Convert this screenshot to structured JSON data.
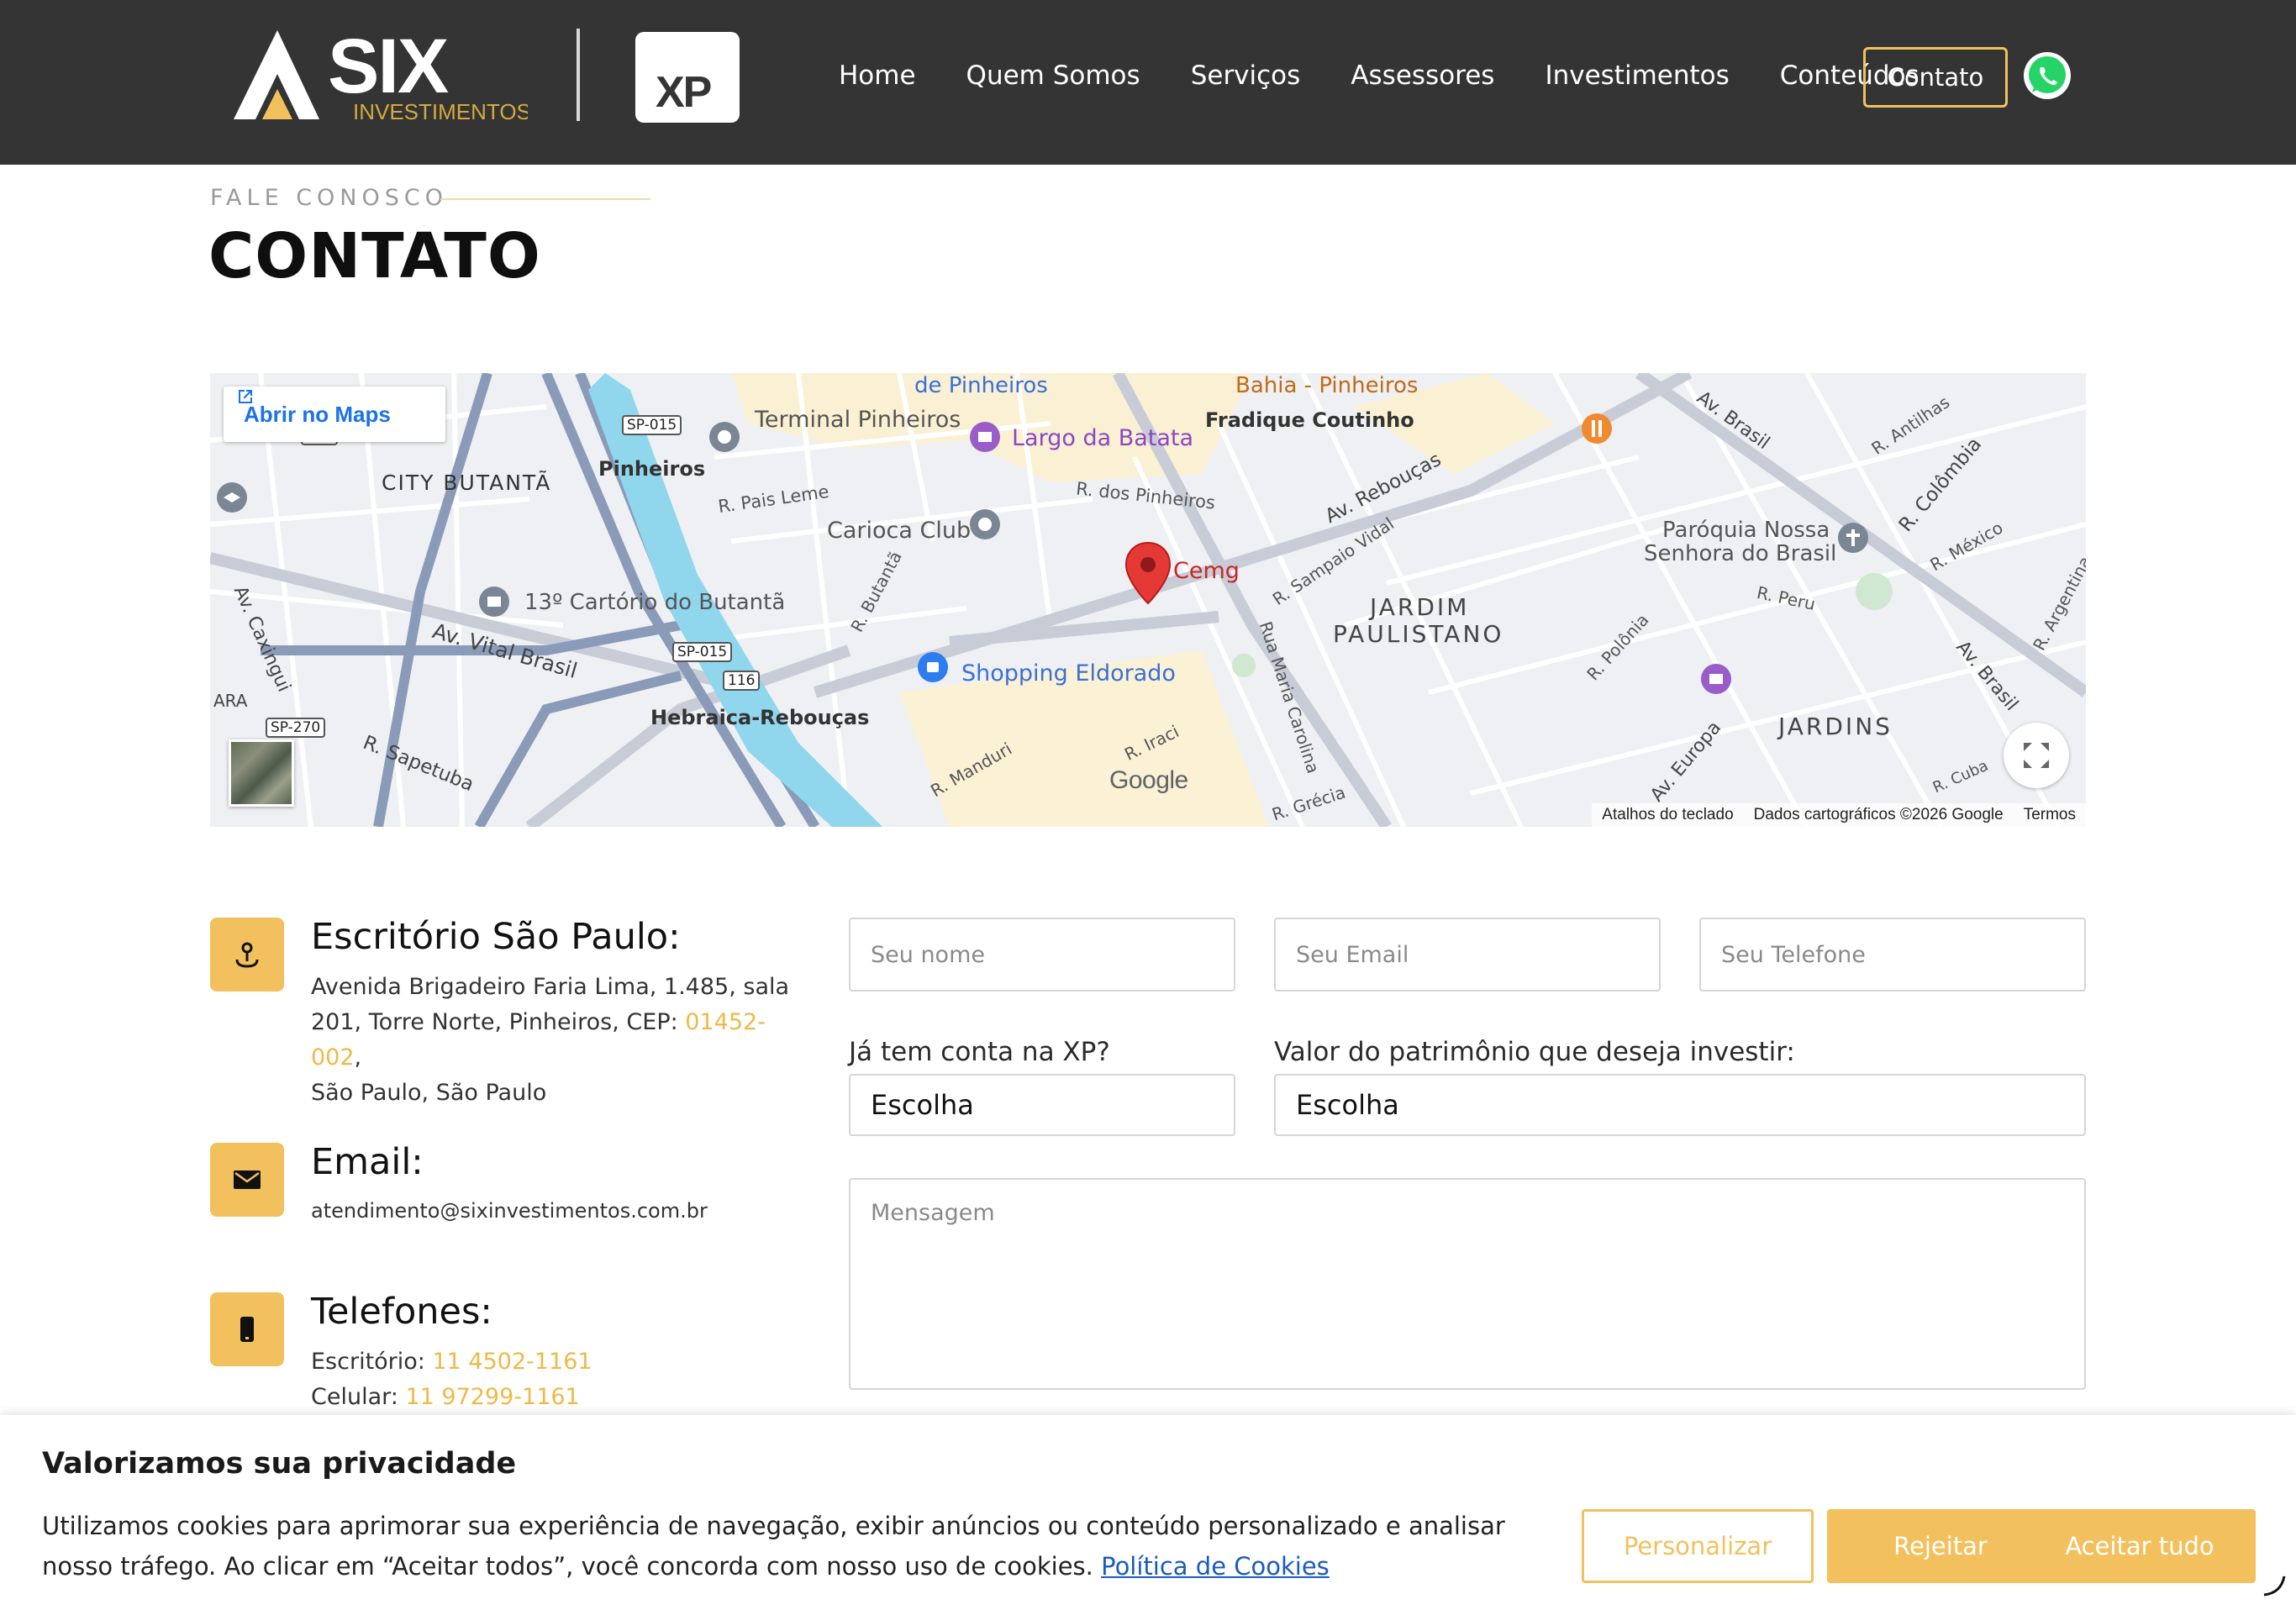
{
  "header": {
    "logo_brand": "SIX",
    "logo_sub": "INVESTIMENTOS",
    "partner_logo": "XP",
    "nav": [
      "Home",
      "Quem Somos",
      "Serviços",
      "Assessores",
      "Investimentos",
      "Conteúdos"
    ],
    "contact_button": "Contato",
    "whatsapp_icon": "whatsapp-icon"
  },
  "title": {
    "eyebrow": "FALE CONOSCO",
    "heading": "CONTATO"
  },
  "map": {
    "open_in_maps": "Abrir no Maps",
    "marker_label": "Cemg",
    "places": {
      "terminal": "Terminal Pinheiros",
      "largo": "Largo da Batata",
      "fradique": "Fradique Coutinho",
      "bahia": "Bahia - Pinheiros",
      "mercado": "de Pinheiros",
      "city": "CITY BUTANTÃ",
      "pinheiros": "Pinheiros",
      "pais_leme": "R. Pais Leme",
      "dos_pinheiros": "R. dos Pinheiros",
      "carioca": "Carioca Club",
      "reboucas": "Av. Rebouças",
      "cartorio": "13º Cartório do Butantã",
      "butanta": "R. Butantã",
      "sampaio": "R. Sampaio Vidal",
      "jardim1": "JARDIM",
      "jardim2": "PAULISTANO",
      "vital": "Av. Vital Brasil",
      "shopping": "Shopping Eldorado",
      "hebraica": "Hebraica-Rebouças",
      "caxingui": "Av. Caxingui",
      "sapetuba": "R. Sapetuba",
      "manduri": "R. Manduri",
      "iraci": "R. Iraci",
      "maria": "Rua Maria Carolina",
      "grecia": "R. Grécia",
      "polonia": "R. Polônia",
      "europa": "Av. Europa",
      "jardins": "JARDINS",
      "paroquia1": "Paróquia Nossa",
      "paroquia2": "Senhora do Brasil",
      "peru": "R. Peru",
      "colombia": "R. Colômbia",
      "mexico": "R. México",
      "antilhas": "R. Antilhas",
      "av_brasil": "Av. Brasil",
      "argentina": "R. Argentina",
      "cuba": "R. Cuba",
      "ara": "ARA",
      "sp015a": "SP-015",
      "sp015b": "SP-015",
      "r116a": "116",
      "r116b": "116",
      "sp270": "SP-270"
    },
    "footer": {
      "shortcuts": "Atalhos do teclado",
      "data": "Dados cartográficos ©2026 Google",
      "terms": "Termos"
    },
    "google": "Google"
  },
  "office": {
    "title": "Escritório São Paulo:",
    "line1": "Avenida Brigadeiro Faria Lima, 1.485, sala",
    "line2a": "201, Torre Norte, Pinheiros, CEP: ",
    "cep": "01452-002",
    "line2b": ",",
    "line3": "São Paulo, São Paulo"
  },
  "email": {
    "title": "Email:",
    "address": "atendimento@sixinvestimentos.com.br"
  },
  "phones": {
    "title": "Telefones:",
    "office_label": "Escritório: ",
    "office_number": "11 4502-1161",
    "cell_label": "Celular: ",
    "cell_number": "11 97299-1161"
  },
  "form": {
    "name_placeholder": "Seu nome",
    "email_placeholder": "Seu Email",
    "phone_placeholder": "Seu Telefone",
    "xp_account_label": "Já tem conta na XP?",
    "xp_account_value": "Escolha",
    "patrimony_label": "Valor do patrimônio que deseja investir:",
    "patrimony_value": "Escolha",
    "message_placeholder": "Mensagem"
  },
  "cookie": {
    "title": "Valorizamos sua privacidade",
    "text": "Utilizamos cookies para aprimorar sua experiência de navegação, exibir anúncios ou conteúdo personalizado e analisar nosso tráfego. Ao clicar em “Aceitar todos”, você concorda com nosso uso de cookies. ",
    "link": "Política de Cookies",
    "customize": "Personalizar",
    "reject": "Rejeitar",
    "accept": "Aceitar tudo"
  },
  "colors": {
    "accent": "#f2c15e",
    "header_bg": "#343434",
    "link": "#1a5bbf"
  }
}
